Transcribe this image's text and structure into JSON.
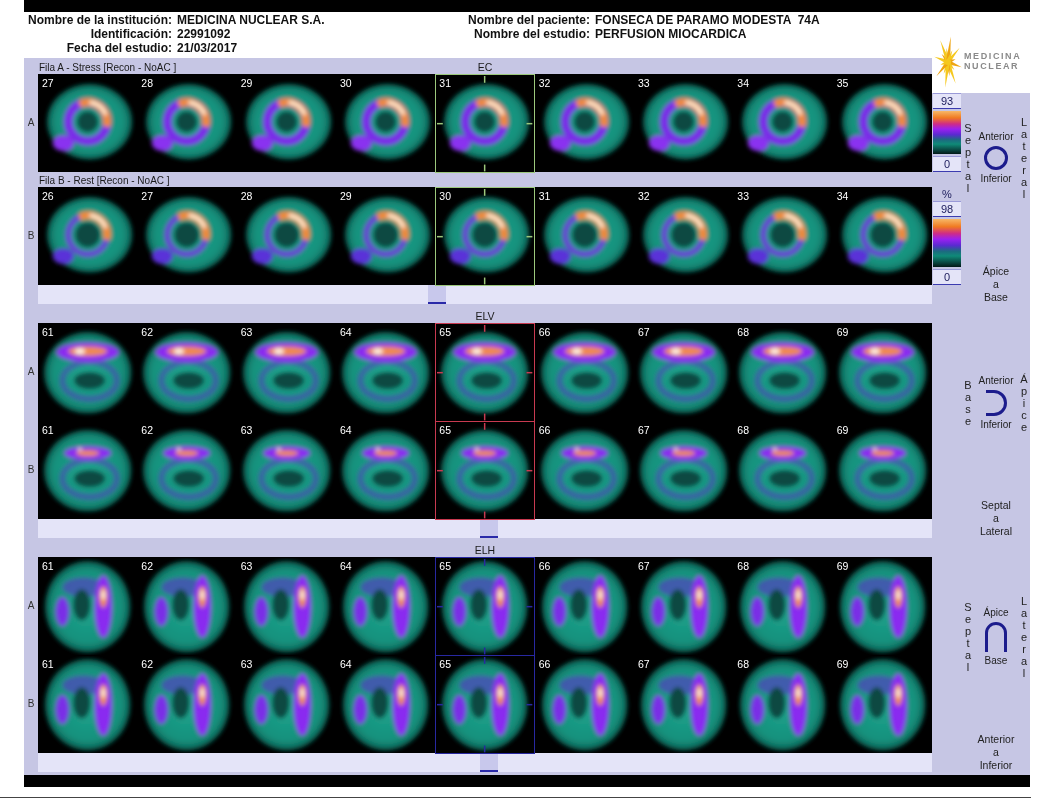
{
  "header": {
    "left": [
      {
        "label": "Nombre de la institución:",
        "value": "MEDICINA NUCLEAR S.A."
      },
      {
        "label": "Identificación:",
        "value": "22991092"
      },
      {
        "label": "Fecha del estudio:",
        "value": "21/03/2017"
      }
    ],
    "right": [
      {
        "label": "Nombre del paciente:",
        "value": "FONSECA DE PARAMO MODESTA  74A"
      },
      {
        "label": "Nombre del estudio:",
        "value": "PERFUSION MIOCARDICA"
      }
    ]
  },
  "logo": {
    "text": "MEDICINA NUCLEAR"
  },
  "sections": [
    {
      "title": "EC",
      "kind": "short",
      "color": "#9cc87c",
      "rows": [
        {
          "label": "A",
          "caption": "Fila A - Stress [Recon - NoAC ]",
          "scale": {
            "max": "93",
            "min": "0"
          },
          "frames": [
            {
              "number": "27",
              "selected": false
            },
            {
              "number": "28",
              "selected": false
            },
            {
              "number": "29",
              "selected": false
            },
            {
              "number": "30",
              "selected": false
            },
            {
              "number": "31",
              "selected": true
            },
            {
              "number": "32",
              "selected": false
            },
            {
              "number": "33",
              "selected": false
            },
            {
              "number": "34",
              "selected": false
            },
            {
              "number": "35",
              "selected": false
            }
          ]
        },
        {
          "label": "B",
          "caption": "Fila B - Rest [Recon - NoAC ]",
          "scale": {
            "unit": "%",
            "max": "98",
            "min": "0"
          },
          "frames": [
            {
              "number": "26",
              "selected": false
            },
            {
              "number": "27",
              "selected": false
            },
            {
              "number": "28",
              "selected": false
            },
            {
              "number": "29",
              "selected": false
            },
            {
              "number": "30",
              "selected": true
            },
            {
              "number": "31",
              "selected": false
            },
            {
              "number": "32",
              "selected": false
            },
            {
              "number": "33",
              "selected": false
            },
            {
              "number": "34",
              "selected": false
            }
          ]
        }
      ],
      "orientation": {
        "top": "Anterior",
        "bottom": "Inferior",
        "left": "Septal",
        "right": "Lateral"
      },
      "direction": "Ápice a Base"
    },
    {
      "title": "ELV",
      "kind": "vertical",
      "color": "#c83a50",
      "rows": [
        {
          "label": "A",
          "frames": [
            {
              "number": "61",
              "selected": false
            },
            {
              "number": "62",
              "selected": false
            },
            {
              "number": "63",
              "selected": false
            },
            {
              "number": "64",
              "selected": false
            },
            {
              "number": "65",
              "selected": true
            },
            {
              "number": "66",
              "selected": false
            },
            {
              "number": "67",
              "selected": false
            },
            {
              "number": "68",
              "selected": false
            },
            {
              "number": "69",
              "selected": false
            }
          ]
        },
        {
          "label": "B",
          "frames": [
            {
              "number": "61",
              "selected": false
            },
            {
              "number": "62",
              "selected": false
            },
            {
              "number": "63",
              "selected": false
            },
            {
              "number": "64",
              "selected": false
            },
            {
              "number": "65",
              "selected": true
            },
            {
              "number": "66",
              "selected": false
            },
            {
              "number": "67",
              "selected": false
            },
            {
              "number": "68",
              "selected": false
            },
            {
              "number": "69",
              "selected": false
            }
          ]
        }
      ],
      "orientation": {
        "top": "Anterior",
        "bottom": "Inferior",
        "left": "Base",
        "right": "Ápice"
      },
      "direction": "Septal a Lateral"
    },
    {
      "title": "ELH",
      "kind": "horizontal",
      "color": "#2828a0",
      "rows": [
        {
          "label": "A",
          "frames": [
            {
              "number": "61",
              "selected": false
            },
            {
              "number": "62",
              "selected": false
            },
            {
              "number": "63",
              "selected": false
            },
            {
              "number": "64",
              "selected": false
            },
            {
              "number": "65",
              "selected": true
            },
            {
              "number": "66",
              "selected": false
            },
            {
              "number": "67",
              "selected": false
            },
            {
              "number": "68",
              "selected": false
            },
            {
              "number": "69",
              "selected": false
            }
          ]
        },
        {
          "label": "B",
          "frames": [
            {
              "number": "61",
              "selected": false
            },
            {
              "number": "62",
              "selected": false
            },
            {
              "number": "63",
              "selected": false
            },
            {
              "number": "64",
              "selected": false
            },
            {
              "number": "65",
              "selected": true
            },
            {
              "number": "66",
              "selected": false
            },
            {
              "number": "67",
              "selected": false
            },
            {
              "number": "68",
              "selected": false
            },
            {
              "number": "69",
              "selected": false
            }
          ]
        }
      ],
      "orientation": {
        "top": "Ápice",
        "bottom": "Base",
        "left": "Septal",
        "right": "Lateral"
      },
      "direction": "Anterior a Inferior"
    }
  ]
}
